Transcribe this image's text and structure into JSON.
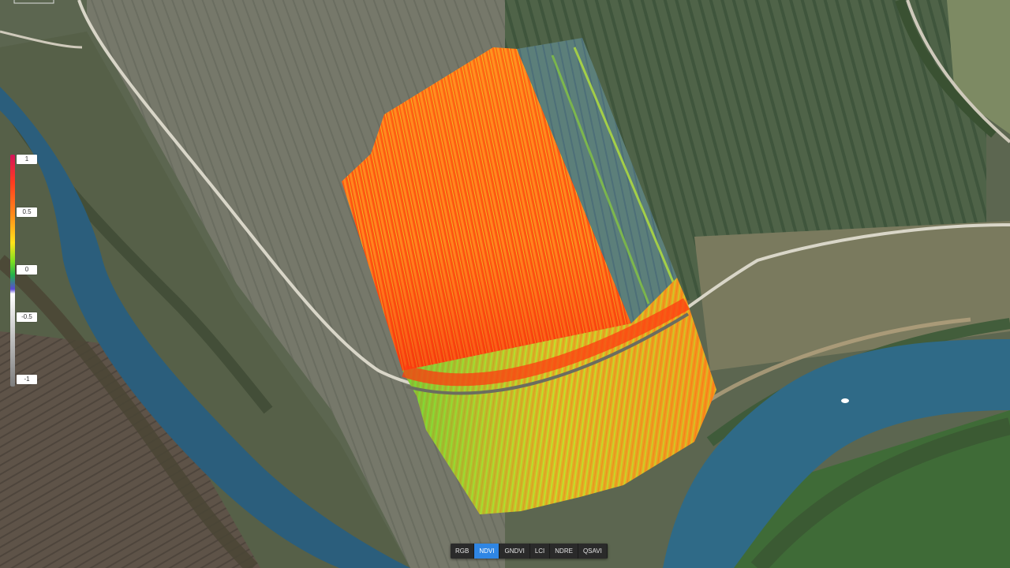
{
  "legend": {
    "ticks": [
      "1",
      "0.5",
      "0",
      "-0.5",
      "-1"
    ]
  },
  "toolbar": {
    "buttons": [
      "RGB",
      "NDVI",
      "GNDVI",
      "LCI",
      "NDRE",
      "QSAVI"
    ],
    "active": "NDVI"
  },
  "colors": {
    "ndvi_high": "#ff3b1f",
    "ndvi_mid": "#ffe21a",
    "ndvi_low": "#22b14c",
    "river": "#2b5e7c",
    "active_button": "#2f86e4"
  }
}
